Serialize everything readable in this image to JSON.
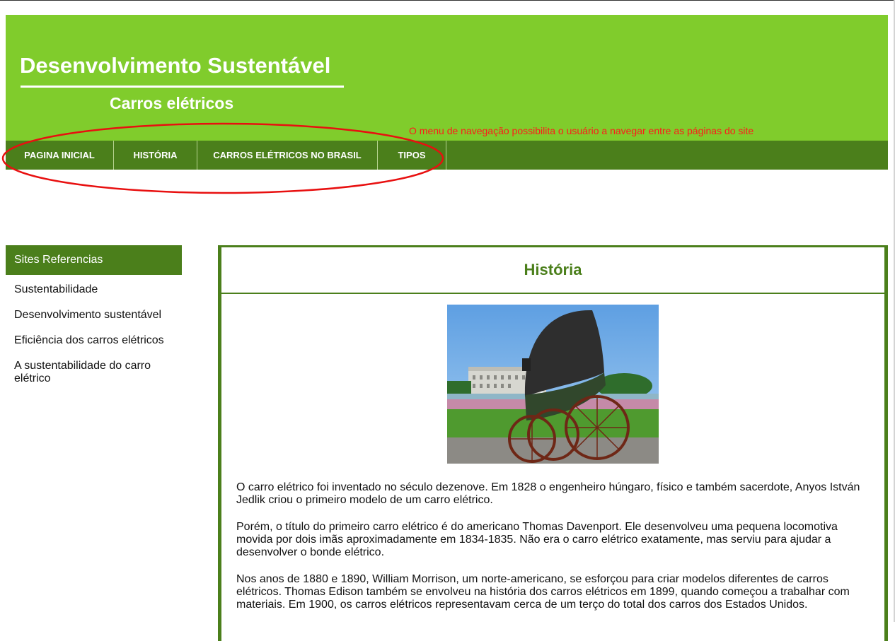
{
  "header": {
    "title": "Desenvolvimento Sustentável",
    "subtitle": "Carros elétricos",
    "annotation": "O menu de navegação possibilita o usuário a navegar entre as páginas do site"
  },
  "nav": {
    "items": [
      "PAGINA INICIAL",
      "HISTÓRIA",
      "CARROS ELÉTRICOS NO BRASIL",
      "TIPOS"
    ]
  },
  "sidebar": {
    "heading": "Sites Referencias",
    "links": [
      "Sustentabilidade",
      "Desenvolvimento sustentável",
      "Eficiência dos carros elétricos",
      "A sustentabilidade do carro elétrico"
    ]
  },
  "main": {
    "title": "História",
    "paragraphs": [
      "O carro elétrico foi inventado no século dezenove. Em 1828 o engenheiro húngaro, físico e também sacerdote, Anyos István Jedlik criou o primeiro modelo de um carro elétrico.",
      "Porém, o título do primeiro carro elétrico é do americano Thomas Davenport. Ele desenvolveu uma pequena locomotiva movida por dois imãs aproximadamente em 1834-1835. Não era o carro elétrico exatamente, mas serviu para ajudar a desenvolver o bonde elétrico.",
      "Nos anos de 1880 e 1890, William Morrison, um norte-americano, se esforçou para criar modelos diferentes de carros elétricos. Thomas Edison também se envolveu na história dos carros elétricos em 1899, quando começou a trabalhar com materiais. Em 1900, os carros elétricos representavam cerca de um terço do total dos carros dos Estados Unidos."
    ]
  },
  "colors": {
    "header_green": "#80cc2c",
    "dark_green": "#4b7f1b",
    "annotation_red": "#ff1a1a"
  }
}
